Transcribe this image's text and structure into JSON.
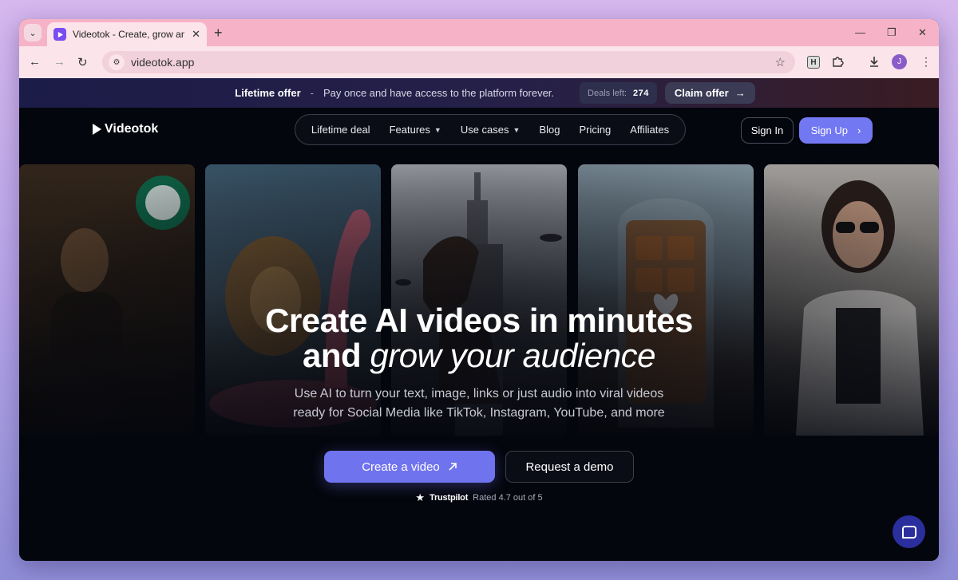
{
  "browser": {
    "tab_title": "Videotok - Create, grow and sc",
    "url": "videotok.app",
    "profile_initial": "J",
    "extension_letter": "H"
  },
  "offer": {
    "title": "Lifetime offer",
    "separator": "-",
    "text": "Pay once and have access to the platform forever.",
    "deals_label": "Deals left:",
    "deals_count": "274",
    "claim_label": "Claim offer",
    "claim_arrow": "→"
  },
  "nav": {
    "logo": "Videotok",
    "items": [
      {
        "label": "Lifetime deal",
        "dropdown": false
      },
      {
        "label": "Features",
        "dropdown": true
      },
      {
        "label": "Use cases",
        "dropdown": true
      },
      {
        "label": "Blog",
        "dropdown": false
      },
      {
        "label": "Pricing",
        "dropdown": false
      },
      {
        "label": "Affiliates",
        "dropdown": false
      }
    ],
    "signin": "Sign In",
    "signup": "Sign Up"
  },
  "hero": {
    "line1": "Create AI videos in minutes",
    "line2_plain": "and",
    "line2_italic": "grow your audience",
    "sub1": "Use AI to turn your text, image, links or just audio into viral videos",
    "sub2": "ready for Social Media like TikTok, Instagram, YouTube, and more",
    "cta_primary": "Create a video",
    "cta_secondary": "Request a demo",
    "trustpilot": "Trustpilot",
    "rating": "Rated 4.7 out of 5"
  },
  "gallery": [
    "mona-lisa-coffee",
    "lion-flamingo-float",
    "horse-empire-state",
    "handbags-glass-dome",
    "woman-sunglasses"
  ],
  "colors": {
    "accent": "#7278f2",
    "page_bg": "#04060d",
    "tab_bar": "#f6b3c7"
  }
}
